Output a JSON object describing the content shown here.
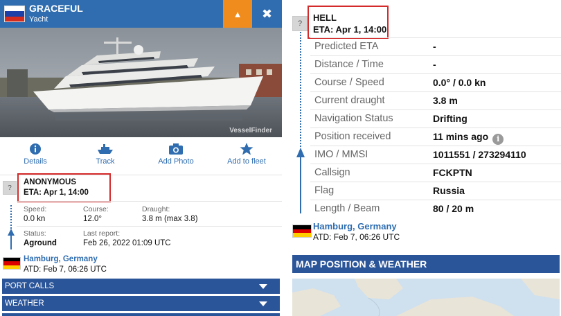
{
  "left": {
    "header": {
      "vessel_name": "GRACEFUL",
      "vessel_type": "Yacht",
      "collapse_icon": "▲",
      "close_icon": "✖"
    },
    "photo": {
      "watermark": "VesselFinder"
    },
    "actions": [
      {
        "label": "Details",
        "icon": "info-icon"
      },
      {
        "label": "Track",
        "icon": "ship-icon"
      },
      {
        "label": "Add Photo",
        "icon": "camera-icon"
      },
      {
        "label": "Add to fleet",
        "icon": "star-icon"
      }
    ],
    "destination": {
      "question": "?",
      "name": "ANONYMOUS",
      "eta": "ETA: Apr 1, 14:00"
    },
    "stats": {
      "speed_label": "Speed:",
      "speed_value": "0.0 kn",
      "course_label": "Course:",
      "course_value": "12.0°",
      "draught_label": "Draught:",
      "draught_value": "3.8 m (max 3.8)",
      "status_label": "Status:",
      "status_value": "Aground",
      "report_label": "Last report:",
      "report_value": "Feb 26, 2022 01:09 UTC"
    },
    "departure": {
      "port": "Hamburg, Germany",
      "atd": "ATD: Feb 7, 06:26 UTC"
    },
    "sections": [
      "PORT CALLS",
      "WEATHER"
    ]
  },
  "right": {
    "destination": {
      "question": "?",
      "name": "HELL",
      "eta": "ETA: Apr 1, 14:00"
    },
    "rows": [
      {
        "label": "Predicted ETA",
        "value": "-"
      },
      {
        "label": "Distance / Time",
        "value": "-"
      },
      {
        "label": "Course / Speed",
        "value": "0.0° / 0.0 kn"
      },
      {
        "label": "Current draught",
        "value": "3.8 m"
      },
      {
        "label": "Navigation Status",
        "value": "Drifting"
      },
      {
        "label": "Position received",
        "value": "11 mins ago"
      },
      {
        "label": "IMO / MMSI",
        "value": "1011551 / 273294110"
      },
      {
        "label": "Callsign",
        "value": "FCKPTN"
      },
      {
        "label": "Flag",
        "value": "Russia"
      },
      {
        "label": "Length / Beam",
        "value": "80 / 20 m"
      }
    ],
    "info_glyph": "i",
    "departure": {
      "port": "Hamburg, Germany",
      "atd": "ATD: Feb 7, 06:26 UTC"
    },
    "map_title": "MAP POSITION & WEATHER"
  },
  "colors": {
    "brand_blue": "#2f6db0",
    "bar_blue": "#2b5599",
    "accent_orange": "#f08c1e",
    "highlight_red": "#d42a2a"
  }
}
